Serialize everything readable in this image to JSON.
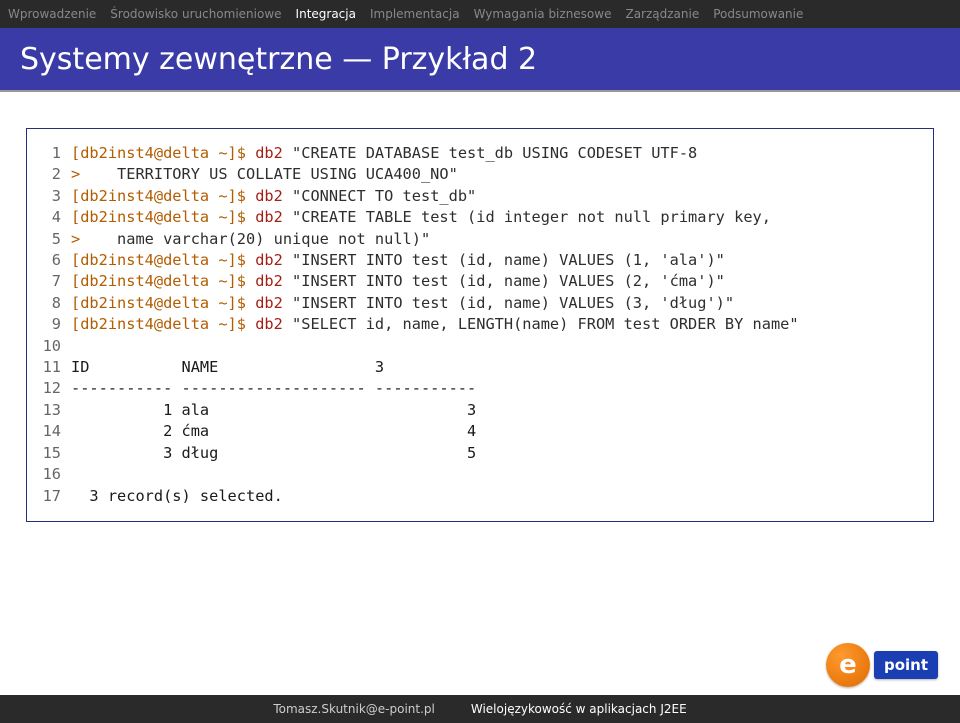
{
  "nav": {
    "items": [
      {
        "label": "Wprowadzenie",
        "active": false
      },
      {
        "label": "Środowisko uruchomieniowe",
        "active": false
      },
      {
        "label": "Integracja",
        "active": true
      },
      {
        "label": "Implementacja",
        "active": false
      },
      {
        "label": "Wymagania biznesowe",
        "active": false
      },
      {
        "label": "Zarządzanie",
        "active": false
      },
      {
        "label": "Podsumowanie",
        "active": false
      }
    ]
  },
  "title": "Systemy zewnętrzne — Przykład 2",
  "code": {
    "lines": [
      {
        "n": "1",
        "prompt": "[db2inst4@delta ~]$ ",
        "cmd": "db2 ",
        "arg": "\"CREATE DATABASE test_db USING CODESET UTF-8"
      },
      {
        "n": "2",
        "prompt": "> ",
        "cmd": "",
        "arg": "   TERRITORY US COLLATE USING UCA400_NO\""
      },
      {
        "n": "3",
        "prompt": "[db2inst4@delta ~]$ ",
        "cmd": "db2 ",
        "arg": "\"CONNECT TO test_db\""
      },
      {
        "n": "4",
        "prompt": "[db2inst4@delta ~]$ ",
        "cmd": "db2 ",
        "arg": "\"CREATE TABLE test (id integer not null primary key,"
      },
      {
        "n": "5",
        "prompt": "> ",
        "cmd": "",
        "arg": "   name varchar(20) unique not null)\""
      },
      {
        "n": "6",
        "prompt": "[db2inst4@delta ~]$ ",
        "cmd": "db2 ",
        "arg": "\"INSERT INTO test (id, name) VALUES (1, 'ala')\""
      },
      {
        "n": "7",
        "prompt": "[db2inst4@delta ~]$ ",
        "cmd": "db2 ",
        "arg": "\"INSERT INTO test (id, name) VALUES (2, 'ćma')\""
      },
      {
        "n": "8",
        "prompt": "[db2inst4@delta ~]$ ",
        "cmd": "db2 ",
        "arg": "\"INSERT INTO test (id, name) VALUES (3, 'dług')\""
      },
      {
        "n": "9",
        "prompt": "[db2inst4@delta ~]$ ",
        "cmd": "db2 ",
        "arg": "\"SELECT id, name, LENGTH(name) FROM test ORDER BY name\""
      },
      {
        "n": "10",
        "plain": ""
      },
      {
        "n": "11",
        "plain": "ID          NAME                 3"
      },
      {
        "n": "12",
        "plain": "----------- -------------------- -----------"
      },
      {
        "n": "13",
        "plain": "          1 ala                            3"
      },
      {
        "n": "14",
        "plain": "          2 ćma                            4"
      },
      {
        "n": "15",
        "plain": "          3 dług                           5"
      },
      {
        "n": "16",
        "plain": ""
      },
      {
        "n": "17",
        "plain": "  3 record(s) selected."
      }
    ]
  },
  "logo": {
    "e": "e",
    "point": "point"
  },
  "footer": {
    "left": "Tomasz.Skutnik@e-point.pl",
    "right": "Wielojęzykowość w aplikacjach J2EE"
  }
}
